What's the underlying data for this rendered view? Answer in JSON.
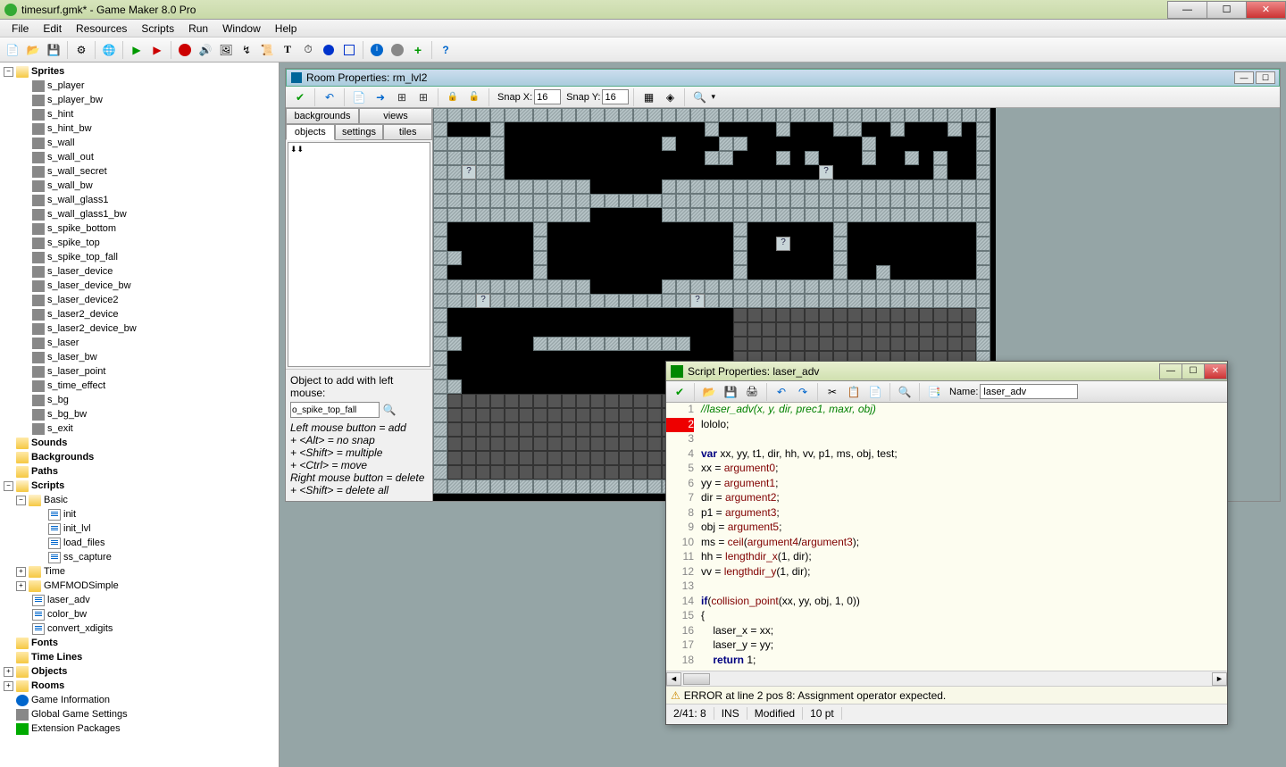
{
  "title": "timesurf.gmk* - Game Maker 8.0 Pro",
  "menu": [
    "File",
    "Edit",
    "Resources",
    "Scripts",
    "Run",
    "Window",
    "Help"
  ],
  "tree": {
    "folders": {
      "sprites": "Sprites",
      "sounds": "Sounds",
      "backgrounds": "Backgrounds",
      "paths": "Paths",
      "scripts": "Scripts",
      "basic": "Basic",
      "time_folder": "Time",
      "gmfmod": "GMFMODSimple",
      "fonts": "Fonts",
      "timelines": "Time Lines",
      "objects": "Objects",
      "rooms": "Rooms",
      "game_info": "Game Information",
      "global_settings": "Global Game Settings",
      "ext_packages": "Extension Packages"
    },
    "sprites": [
      "s_player",
      "s_player_bw",
      "s_hint",
      "s_hint_bw",
      "s_wall",
      "s_wall_out",
      "s_wall_secret",
      "s_wall_bw",
      "s_wall_glass1",
      "s_wall_glass1_bw",
      "s_spike_bottom",
      "s_spike_top",
      "s_spike_top_fall",
      "s_laser_device",
      "s_laser_device_bw",
      "s_laser_device2",
      "s_laser2_device",
      "s_laser2_device_bw",
      "s_laser",
      "s_laser_bw",
      "s_laser_point",
      "s_time_effect",
      "s_bg",
      "s_bg_bw",
      "s_exit"
    ],
    "basic_scripts": [
      "init",
      "init_lvl",
      "load_files",
      "ss_capture"
    ],
    "scripts": [
      "laser_adv",
      "color_bw",
      "convert_xdigits"
    ]
  },
  "room": {
    "title": "Room Properties: rm_lvl2",
    "snapx_label": "Snap X:",
    "snapx": "16",
    "snapy_label": "Snap Y:",
    "snapy": "16",
    "tabs": [
      "backgrounds",
      "views",
      "objects",
      "settings",
      "tiles"
    ],
    "obj_add_label": "Object to add with left mouse:",
    "obj_input": "o_spike_top_fall",
    "help1": "Left mouse button = add",
    "help2": "+ <Alt> = no snap",
    "help3": "+ <Shift> = multiple",
    "help4": "+ <Ctrl> = move",
    "help5": "Right mouse button = delete",
    "help6": "+ <Shift> = delete all"
  },
  "script": {
    "title": "Script Properties: laser_adv",
    "name_label": "Name:",
    "name": "laser_adv",
    "lines": [
      "//laser_adv(x, y, dir, prec1, maxr, obj)",
      "lololo;",
      "",
      "var xx, yy, t1, dir, hh, vv, p1, ms, obj, test;",
      "xx = argument0;",
      "yy = argument1;",
      "dir = argument2;",
      "p1 = argument3;",
      "obj = argument5;",
      "ms = ceil(argument4/argument3);",
      "hh = lengthdir_x(1, dir);",
      "vv = lengthdir_y(1, dir);",
      "",
      "if(collision_point(xx, yy, obj, 1, 0))",
      "{",
      "    laser_x = xx;",
      "    laser_y = yy;",
      "    return 1;"
    ],
    "error": "ERROR at line 2 pos 8: Assignment operator expected.",
    "status_pos": "2/41:  8",
    "status_ins": "INS",
    "status_mod": "Modified",
    "status_pt": "10 pt"
  }
}
